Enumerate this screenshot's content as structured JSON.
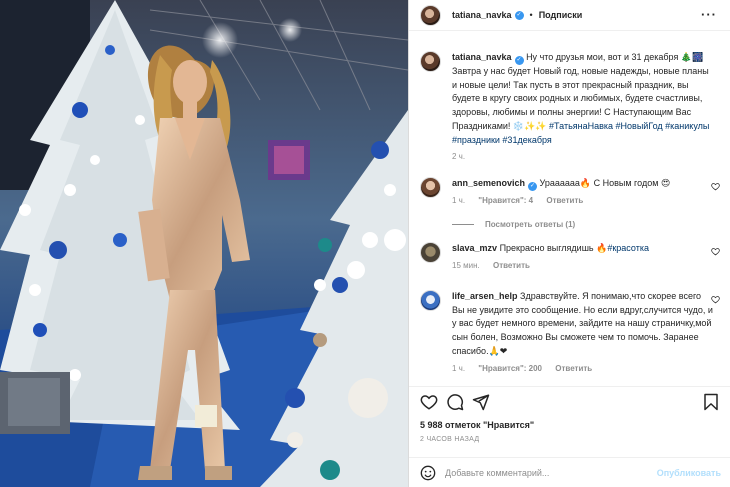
{
  "post": {
    "author": "tatiana_navka",
    "verified": true,
    "follow_label": "Подписки",
    "separator": "•",
    "more_icon": "more-horizontal-icon"
  },
  "caption": {
    "username": "tatiana_navka",
    "text": "Ну что друзья мои, вот и 31 декабря 🎄🎆 Завтра у нас будет Новый год, новые надежды, новые планы и новые цели! Так пусть в этот прекрасный праздник, вы будете в кругу своих родных и любимых, будете счастливы, здоровы, любимы и полны энергии! С Наступающим Вас Праздниками! ❄️✨✨",
    "hashtags": "#ТатьянаНавка #НовыйГод #каникулы #праздники #31декабря",
    "time": "2 ч."
  },
  "comments": [
    {
      "username": "ann_semenovich",
      "verified": true,
      "text": "Ураааааа🔥 С Новым годом 😍",
      "time": "1 ч.",
      "likes": "\"Нравится\": 4",
      "reply_label": "Ответить",
      "view_replies": "Посмотреть ответы (1)"
    },
    {
      "username": "slava_mzv",
      "verified": false,
      "text": "Прекрасно выглядишь 🔥",
      "tag": "#красотка",
      "time": "15 мин.",
      "reply_label": "Ответить"
    },
    {
      "username": "life_arsen_help",
      "verified": false,
      "text": "Здравствуйте. Я понимаю,что скорее всего Вы не увидите это сообщение. Но если вдруг,случится чудо, и у вас будет немного времени, зайдите на нашу страничку,мой сын болен, Возможно Вы сможете чем то помочь. Заранее спасибо.🙏❤",
      "time": "1 ч.",
      "likes": "\"Нравится\": 200",
      "reply_label": "Ответить"
    }
  ],
  "actions": {
    "icons": [
      "heart-icon",
      "comment-icon",
      "share-icon",
      "bookmark-icon"
    ],
    "likes_label": "5 988 отметок \"Нравится\"",
    "posted_ago": "2 ЧАСОВ НАЗАД"
  },
  "add_comment": {
    "placeholder": "Добавьте комментарий...",
    "publish_label": "Опубликовать"
  },
  "colors": {
    "link": "#00376b",
    "muted": "#8e8e8e",
    "verified": "#3897f0",
    "publish_disabled": "#b2dffc"
  }
}
